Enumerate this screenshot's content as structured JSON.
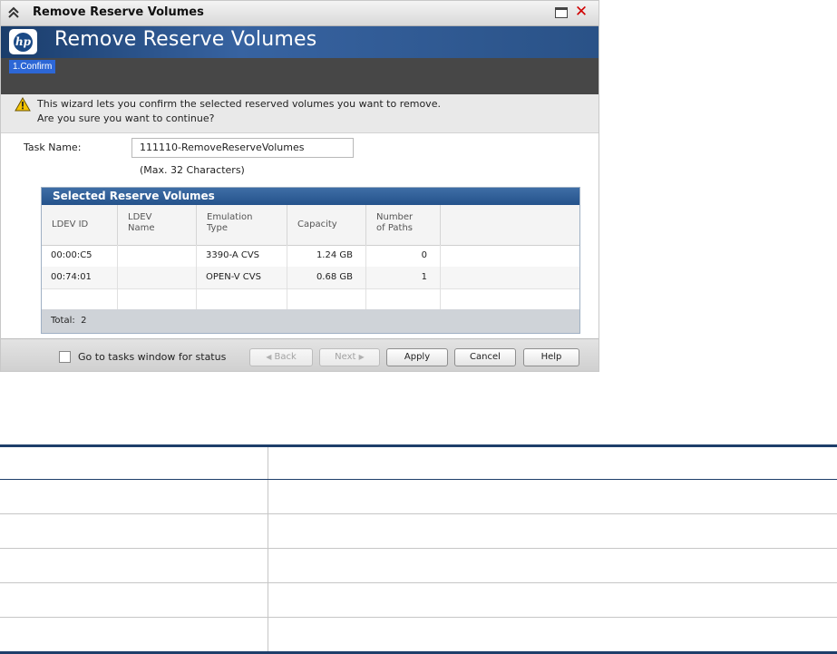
{
  "window": {
    "title": "Remove Reserve Volumes"
  },
  "banner": {
    "logo_text": "hp",
    "title": "Remove Reserve Volumes"
  },
  "steps": [
    "1.Confirm"
  ],
  "message": {
    "line1": "This wizard lets you confirm the selected reserved volumes you want to remove.",
    "line2": "Are you sure you want to continue?"
  },
  "task": {
    "label": "Task Name:",
    "value": "111110-RemoveReserveVolumes",
    "hint": "(Max. 32 Characters)"
  },
  "volumes": {
    "title": "Selected Reserve Volumes",
    "columns": [
      [
        "LDEV ID"
      ],
      [
        "LDEV",
        "Name"
      ],
      [
        "Emulation",
        "Type"
      ],
      [
        "Capacity"
      ],
      [
        "Number",
        "of Paths"
      ]
    ],
    "rows": [
      {
        "ldev_id": "00:00:C5",
        "ldev_name": "",
        "emulation": "3390-A CVS",
        "capacity": "1.24 GB",
        "paths": "0"
      },
      {
        "ldev_id": "00:74:01",
        "ldev_name": "",
        "emulation": "OPEN-V CVS",
        "capacity": "0.68 GB",
        "paths": "1"
      }
    ],
    "total_label": "Total:",
    "total_value": "2"
  },
  "footer": {
    "checkbox_label": "Go to tasks window for status",
    "back": "Back",
    "next": "Next",
    "apply": "Apply",
    "cancel": "Cancel",
    "help": "Help"
  },
  "colors": {
    "banner": "#2a5287",
    "step_active": "#2d67d6",
    "panel_header": "#24528b",
    "close": "#d00000"
  }
}
